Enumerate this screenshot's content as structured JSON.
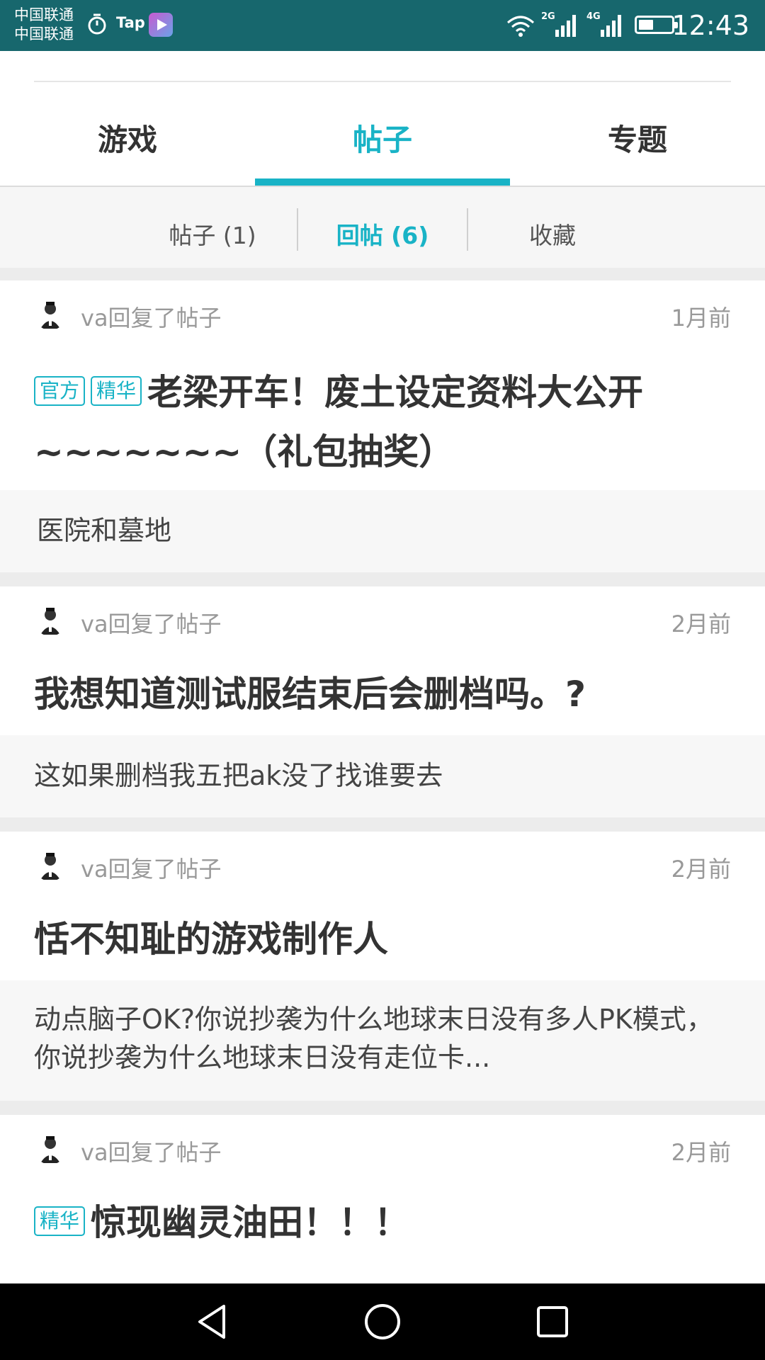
{
  "status_bar": {
    "carrier_1": "中国联通",
    "carrier_2": "中国联通",
    "tap_label": "Tap",
    "net_2g": "2G",
    "net_4g": "4G",
    "battery_level": 0.45,
    "time": "12:43",
    "icons": [
      "alarm-icon",
      "tap-app-icon",
      "video-app-icon",
      "wifi-icon",
      "signal-icon",
      "battery-icon"
    ]
  },
  "tabs": [
    {
      "label": "游戏",
      "active": false
    },
    {
      "label": "帖子",
      "active": true
    },
    {
      "label": "专题",
      "active": false
    }
  ],
  "sub_tabs": [
    {
      "label": "帖子 (1)",
      "active": false
    },
    {
      "label": "回帖 (6)",
      "active": true
    },
    {
      "label": "收藏",
      "active": false
    }
  ],
  "posts": [
    {
      "meta": "va回复了帖子",
      "time": "1月前",
      "badges": [
        "官方",
        "精华"
      ],
      "title": "老梁开车！废土设定资料大公开~~~~~~~（礼包抽奖）",
      "excerpt": "医院和墓地"
    },
    {
      "meta": "va回复了帖子",
      "time": "2月前",
      "badges": [],
      "title": "我想知道测试服结束后会删档吗。?",
      "excerpt": "这如果删档我五把ak没了找谁要去"
    },
    {
      "meta": "va回复了帖子",
      "time": "2月前",
      "badges": [],
      "title": "恬不知耻的游戏制作人",
      "excerpt": "动点脑子OK?你说抄袭为什么地球末日没有多人PK模式，你说抄袭为什么地球末日没有走位卡..."
    },
    {
      "meta": "va回复了帖子",
      "time": "2月前",
      "badges": [
        "精华"
      ],
      "title": "惊现幽灵油田！！！",
      "excerpt": ""
    }
  ],
  "accent_color": "#19b3c6",
  "status_bar_color": "#17676d"
}
